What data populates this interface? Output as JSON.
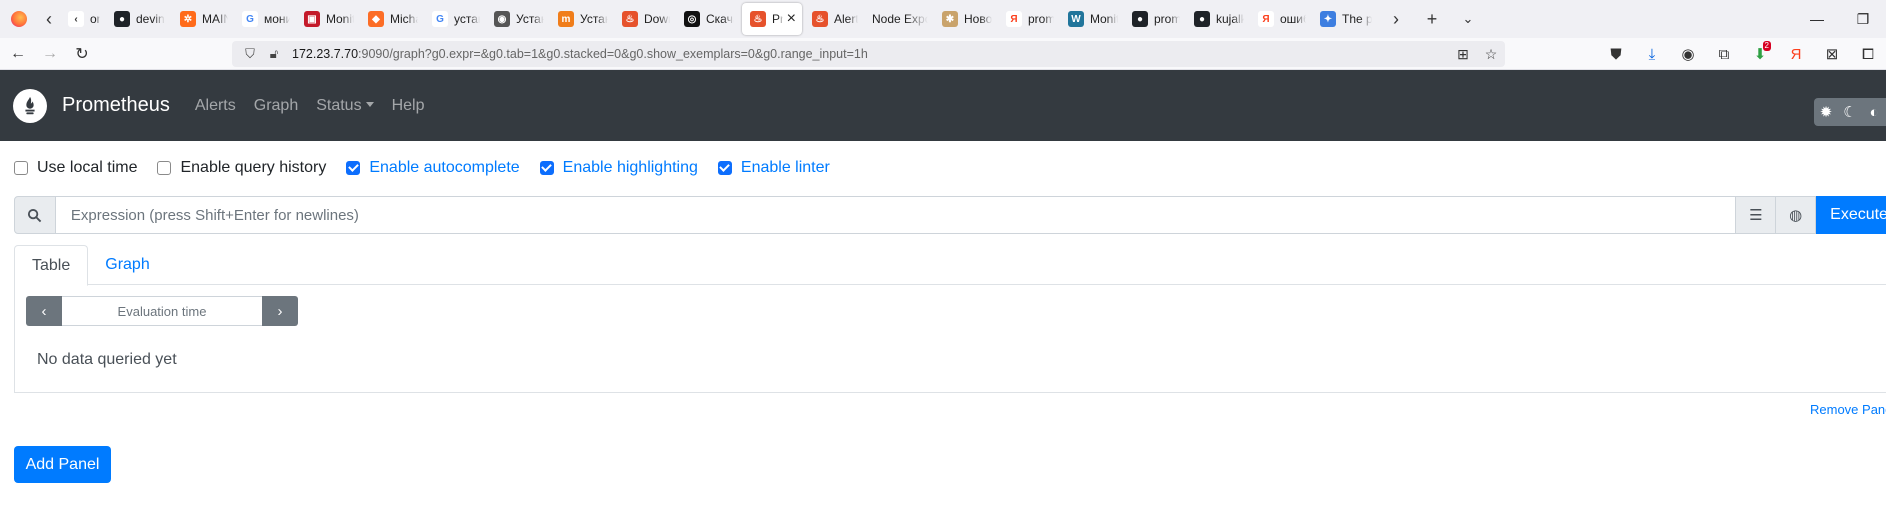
{
  "browser": {
    "tabs": [
      {
        "title": "onit",
        "fav_color": "#ffffff",
        "fav_text": "‹",
        "fav_fg": "#333333"
      },
      {
        "title": "devin",
        "fav_color": "#1f2328",
        "fav_text": "●",
        "fav_fg": "#ffffff"
      },
      {
        "title": "MAIN",
        "fav_color": "#ff6b1a",
        "fav_text": "✲",
        "fav_fg": "#ffffff"
      },
      {
        "title": "мони",
        "fav_color": "#ffffff",
        "fav_text": "G",
        "fav_fg": "#4285f4"
      },
      {
        "title": "Monit",
        "fav_color": "#c41a2a",
        "fav_text": "▣",
        "fav_fg": "#ffffff"
      },
      {
        "title": "Micha",
        "fav_color": "#fc6d26",
        "fav_text": "◆",
        "fav_fg": "#ffffff"
      },
      {
        "title": "устан",
        "fav_color": "#ffffff",
        "fav_text": "G",
        "fav_fg": "#4285f4"
      },
      {
        "title": "Устан",
        "fav_color": "#555555",
        "fav_text": "◉",
        "fav_fg": "#ffffff"
      },
      {
        "title": "Устан",
        "fav_color": "#f07d1a",
        "fav_text": "m",
        "fav_fg": "#ffffff"
      },
      {
        "title": "Down",
        "fav_color": "#e6522c",
        "fav_text": "♨",
        "fav_fg": "#ffffff"
      },
      {
        "title": "Скача",
        "fav_color": "#111111",
        "fav_text": "◎",
        "fav_fg": "#ffffff"
      },
      {
        "title": "Pro",
        "fav_color": "#e6522c",
        "fav_text": "♨",
        "fav_fg": "#ffffff",
        "active": true
      },
      {
        "title": "Alertn",
        "fav_color": "#e6522c",
        "fav_text": "♨",
        "fav_fg": "#ffffff"
      },
      {
        "title": "Node Expo",
        "fav_color": "#f0f0f4",
        "fav_text": "",
        "fav_fg": "#333333"
      },
      {
        "title": "Ново",
        "fav_color": "#c9a36b",
        "fav_text": "✱",
        "fav_fg": "#ffffff"
      },
      {
        "title": "prom",
        "fav_color": "#ffffff",
        "fav_text": "Я",
        "fav_fg": "#fc3f1d"
      },
      {
        "title": "Monit",
        "fav_color": "#21759b",
        "fav_text": "W",
        "fav_fg": "#ffffff"
      },
      {
        "title": "prom",
        "fav_color": "#1f2328",
        "fav_text": "●",
        "fav_fg": "#ffffff"
      },
      {
        "title": "kujalk",
        "fav_color": "#1f2328",
        "fav_text": "●",
        "fav_fg": "#ffffff"
      },
      {
        "title": "ошиб",
        "fav_color": "#ffffff",
        "fav_text": "Я",
        "fav_fg": "#fc3f1d"
      },
      {
        "title": "The p",
        "fav_color": "#3d7ee0",
        "fav_text": "✦",
        "fav_fg": "#ffffff"
      }
    ],
    "url_host": "172.23.7.70",
    "url_rest": ":9090/graph?g0.expr=&g0.tab=1&g0.stacked=0&g0.show_exemplars=0&g0.range_input=1h",
    "download_badge": "2"
  },
  "prometheus": {
    "brand": "Prometheus",
    "nav": {
      "alerts": "Alerts",
      "graph": "Graph",
      "status": "Status",
      "help": "Help"
    },
    "options": [
      {
        "label": "Use local time",
        "checked": false
      },
      {
        "label": "Enable query history",
        "checked": false
      },
      {
        "label": "Enable autocomplete",
        "checked": true
      },
      {
        "label": "Enable highlighting",
        "checked": true
      },
      {
        "label": "Enable linter",
        "checked": true
      }
    ],
    "expression": {
      "placeholder": "Expression (press Shift+Enter for newlines)",
      "value": "",
      "execute_label": "Execute"
    },
    "panel": {
      "tabs": {
        "table": "Table",
        "graph": "Graph"
      },
      "active_tab": "Table",
      "eval_placeholder": "Evaluation time",
      "no_data": "No data queried yet",
      "remove_label": "Remove Panel"
    },
    "add_panel_label": "Add Panel"
  },
  "colors": {
    "header_bg": "#343a40",
    "primary": "#007bff",
    "secondary": "#6c757d"
  }
}
